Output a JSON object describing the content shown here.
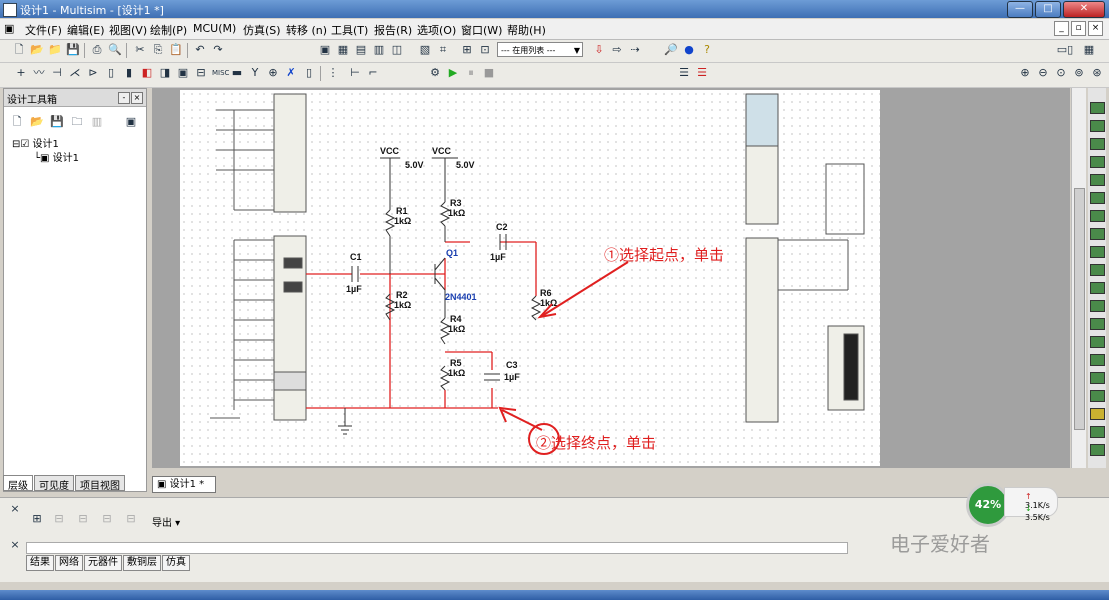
{
  "window": {
    "title": "设计1 - Multisim - [设计1 *]"
  },
  "menu": [
    "文件(F)",
    "编辑(E)",
    "视图(V)",
    "绘制(P)",
    "MCU(M)",
    "仿真(S)",
    "转移 (n)",
    "工具(T)",
    "报告(R)",
    "选项(O)",
    "窗口(W)",
    "帮助(H)"
  ],
  "toolbar": {
    "inuse_list": "--- 在用列表 ---"
  },
  "design_toolbox": {
    "title": "设计工具箱",
    "tree": [
      "设计1",
      "设计1"
    ],
    "tabs": [
      "层级",
      "可见度",
      "项目视图"
    ]
  },
  "doc_tab": "设计1 *",
  "schematic": {
    "vcc_labels": [
      "VCC",
      "VCC"
    ],
    "vcc_values": [
      "5.0V",
      "5.0V"
    ],
    "components": [
      {
        "ref": "R1",
        "value": "1kΩ"
      },
      {
        "ref": "R2",
        "value": "1kΩ"
      },
      {
        "ref": "R3",
        "value": "1kΩ"
      },
      {
        "ref": "R4",
        "value": "1kΩ"
      },
      {
        "ref": "R5",
        "value": "1kΩ"
      },
      {
        "ref": "R6",
        "value": "1kΩ"
      },
      {
        "ref": "C1",
        "value": "1µF"
      },
      {
        "ref": "C2",
        "value": "1µF"
      },
      {
        "ref": "C3",
        "value": "1µF"
      },
      {
        "ref": "Q1",
        "value": "2N4401"
      }
    ],
    "annotations": [
      "①选择起点，单击",
      "②选择终点，单击"
    ]
  },
  "spreadsheet": {
    "export_label": "导出",
    "tabs": [
      "结果",
      "网络",
      "元器件",
      "敷铜层",
      "仿真"
    ]
  },
  "overlay": {
    "gauge_percent": "42%",
    "upload": "3.1K/s",
    "download": "3.5K/s",
    "watermark": "电子爱好者"
  },
  "colors": {
    "wire": "#e02020",
    "titlebar": "#3e6fb3",
    "accent": "#e02020"
  }
}
